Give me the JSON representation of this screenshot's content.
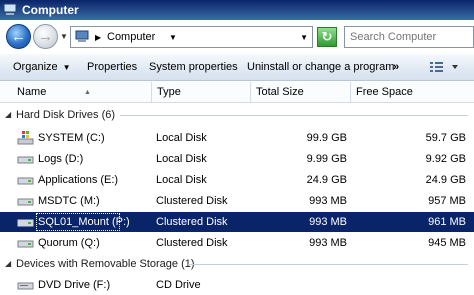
{
  "window": {
    "title": "Computer"
  },
  "address": {
    "crumb": "Computer",
    "search_placeholder": "Search Computer"
  },
  "toolbar": {
    "organize": "Organize",
    "properties": "Properties",
    "system_properties": "System properties",
    "uninstall": "Uninstall or change a program",
    "more": "»"
  },
  "columns": {
    "name": "Name",
    "type": "Type",
    "total_size": "Total Size",
    "free_space": "Free Space"
  },
  "groups": {
    "hard_disks": {
      "label": "Hard Disk Drives (6)",
      "items": [
        {
          "name": "SYSTEM (C:)",
          "type": "Local Disk",
          "total": "99.9 GB",
          "free": "59.7 GB"
        },
        {
          "name": "Logs (D:)",
          "type": "Local Disk",
          "total": "9.99 GB",
          "free": "9.92 GB"
        },
        {
          "name": "Applications (E:)",
          "type": "Local Disk",
          "total": "24.9 GB",
          "free": "24.9 GB"
        },
        {
          "name": "MSDTC (M:)",
          "type": "Clustered Disk",
          "total": "993 MB",
          "free": "957 MB"
        },
        {
          "name": "SQL01_Mount (P:)",
          "type": "Clustered Disk",
          "total": "993 MB",
          "free": "961 MB"
        },
        {
          "name": "Quorum (Q:)",
          "type": "Clustered Disk",
          "total": "993 MB",
          "free": "945 MB"
        }
      ]
    },
    "removable": {
      "label": "Devices with Removable Storage (1)",
      "items": [
        {
          "name": "DVD Drive (F:)",
          "type": "CD Drive",
          "total": "",
          "free": ""
        }
      ]
    }
  },
  "icons": {
    "title": "computer-icon",
    "back": "back-arrow-icon",
    "forward": "forward-arrow-icon",
    "refresh": "refresh-icon",
    "system_drive": "windows-drive-icon",
    "disk": "disk-drive-icon",
    "dvd": "dvd-drive-icon",
    "views": "views-icon"
  },
  "colors": {
    "selection": "#0a246a",
    "title_bar": "#0a246a"
  }
}
